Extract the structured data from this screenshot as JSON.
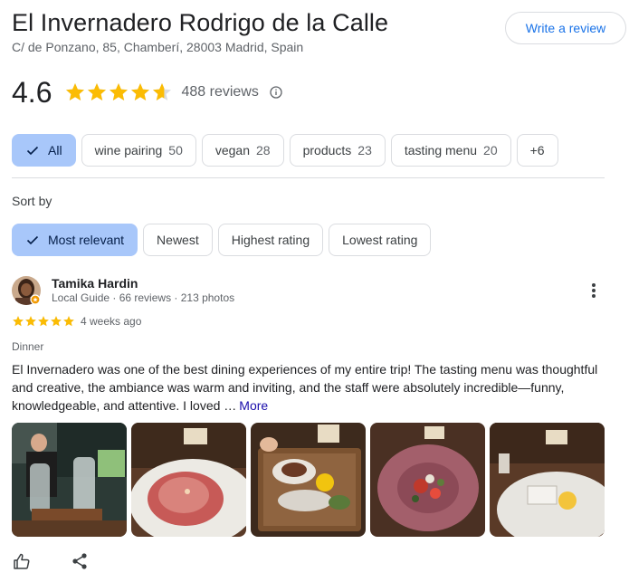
{
  "place": {
    "name": "El Invernadero Rodrigo de la Calle",
    "address": "C/ de Ponzano, 85, Chamberí, 28003 Madrid, Spain",
    "write_review_label": "Write a review"
  },
  "rating": {
    "value": "4.6",
    "stars": 4.6,
    "reviews_count": "488 reviews",
    "star_color": "#fbbc04"
  },
  "topics": {
    "selected": "All",
    "items": [
      {
        "label": "All",
        "count": ""
      },
      {
        "label": "wine pairing",
        "count": "50"
      },
      {
        "label": "vegan",
        "count": "28"
      },
      {
        "label": "products",
        "count": "23"
      },
      {
        "label": "tasting menu",
        "count": "20"
      },
      {
        "label": "+6",
        "count": ""
      }
    ]
  },
  "sort": {
    "label": "Sort by",
    "selected": "Most relevant",
    "options": [
      "Most relevant",
      "Newest",
      "Highest rating",
      "Lowest rating"
    ]
  },
  "review": {
    "reviewer_name": "Tamika Hardin",
    "reviewer_meta": "Local Guide · 66 reviews · 213 photos",
    "stars": 5,
    "date": "4 weeks ago",
    "meal": "Dinner",
    "text": "El Invernadero was one of the best dining experiences of my entire trip! The tasting menu was thoughtful and creative, the ambiance was warm and inviting, and the staff were absolutely incredible—funny, knowledgeable, and attentive. I loved …",
    "more_label": "More",
    "photo_count": 5
  },
  "colors": {
    "accent": "#1a73e8",
    "chip_selected": "#a8c7fa",
    "link": "#1a0dab"
  }
}
